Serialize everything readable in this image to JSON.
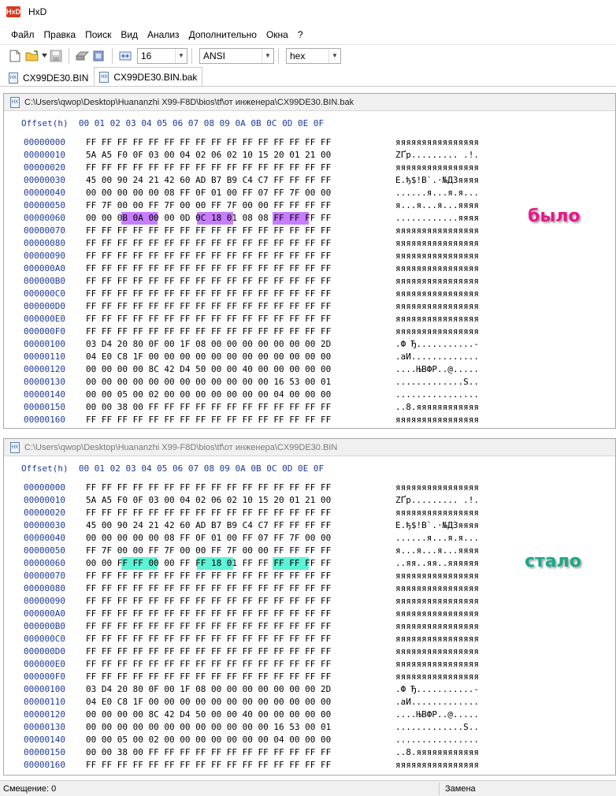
{
  "app": {
    "title": "HxD",
    "logo_text": "HxD"
  },
  "menu": [
    "Файл",
    "Правка",
    "Поиск",
    "Вид",
    "Анализ",
    "Дополнительно",
    "Окна",
    "?"
  ],
  "toolbar": {
    "icons": [
      "new-file-icon",
      "open-file-icon",
      "save-icon",
      "disk-icon",
      "ram-icon",
      "columns-icon"
    ],
    "bytes_per_row": "16",
    "charset": "ANSI",
    "display_mode": "hex"
  },
  "tabs": [
    {
      "label": "CX99DE30.BIN",
      "active": false
    },
    {
      "label": "CX99DE30.BIN.bak",
      "active": true
    }
  ],
  "header_row": "Offset(h)  00 01 02 03 04 05 06 07 08 09 0A 0B 0C 0D 0E 0F",
  "panels": [
    {
      "path": "C:\\Users\\qwop\\Desktop\\Huananzhi X99-F8D\\bios\\tf\\от инженера\\CX99DE30.BIN.bak",
      "label": "было",
      "label_color": "#e6198a",
      "highlight_color": "#c77dff",
      "highlights": [
        [
          6,
          2,
          3
        ],
        [
          6,
          6,
          7
        ],
        [
          6,
          10,
          11
        ]
      ],
      "rows": [
        {
          "offset": "00000000",
          "hex": "FF FF FF FF FF FF FF FF FF FF FF FF FF FF FF FF",
          "ascii": "яяяяяяяяяяяяяяяя"
        },
        {
          "offset": "00000010",
          "hex": "5A A5 F0 0F 03 00 04 02 06 02 10 15 20 01 21 00",
          "ascii": "ZҐр......... .!."
        },
        {
          "offset": "00000020",
          "hex": "FF FF FF FF FF FF FF FF FF FF FF FF FF FF FF FF",
          "ascii": "яяяяяяяяяяяяяяяя"
        },
        {
          "offset": "00000030",
          "hex": "45 00 90 24 21 42 60 AD B7 B9 C4 C7 FF FF FF FF",
          "ascii": "E.ђ$!B`.·№ДЗяяяя"
        },
        {
          "offset": "00000040",
          "hex": "00 00 00 00 00 08 FF 0F 01 00 FF 07 FF 7F 00 00",
          "ascii": "......я...я.я..."
        },
        {
          "offset": "00000050",
          "hex": "FF 7F 00 00 FF 7F 00 00 FF 7F 00 00 FF FF FF FF",
          "ascii": "я...я...я...яяяя"
        },
        {
          "offset": "00000060",
          "hex": "00 00 0B 0A 00 00 0D 0C 18 01 08 08 FF FF FF FF",
          "ascii": "............яяяя"
        },
        {
          "offset": "00000070",
          "hex": "FF FF FF FF FF FF FF FF FF FF FF FF FF FF FF FF",
          "ascii": "яяяяяяяяяяяяяяяя"
        },
        {
          "offset": "00000080",
          "hex": "FF FF FF FF FF FF FF FF FF FF FF FF FF FF FF FF",
          "ascii": "яяяяяяяяяяяяяяяя"
        },
        {
          "offset": "00000090",
          "hex": "FF FF FF FF FF FF FF FF FF FF FF FF FF FF FF FF",
          "ascii": "яяяяяяяяяяяяяяяя"
        },
        {
          "offset": "000000A0",
          "hex": "FF FF FF FF FF FF FF FF FF FF FF FF FF FF FF FF",
          "ascii": "яяяяяяяяяяяяяяяя"
        },
        {
          "offset": "000000B0",
          "hex": "FF FF FF FF FF FF FF FF FF FF FF FF FF FF FF FF",
          "ascii": "яяяяяяяяяяяяяяяя"
        },
        {
          "offset": "000000C0",
          "hex": "FF FF FF FF FF FF FF FF FF FF FF FF FF FF FF FF",
          "ascii": "яяяяяяяяяяяяяяяя"
        },
        {
          "offset": "000000D0",
          "hex": "FF FF FF FF FF FF FF FF FF FF FF FF FF FF FF FF",
          "ascii": "яяяяяяяяяяяяяяяя"
        },
        {
          "offset": "000000E0",
          "hex": "FF FF FF FF FF FF FF FF FF FF FF FF FF FF FF FF",
          "ascii": "яяяяяяяяяяяяяяяя"
        },
        {
          "offset": "000000F0",
          "hex": "FF FF FF FF FF FF FF FF FF FF FF FF FF FF FF FF",
          "ascii": "яяяяяяяяяяяяяяяя"
        },
        {
          "offset": "00000100",
          "hex": "03 D4 20 80 0F 00 1F 08 00 00 00 00 00 00 00 2D",
          "ascii": ".Ф Ђ...........-"
        },
        {
          "offset": "00000110",
          "hex": "04 E0 C8 1F 00 00 00 00 00 00 00 00 00 00 00 00",
          "ascii": ".аИ............."
        },
        {
          "offset": "00000120",
          "hex": "00 00 00 00 8C 42 D4 50 00 00 40 00 00 00 00 00",
          "ascii": "....ЊBФP..@....."
        },
        {
          "offset": "00000130",
          "hex": "00 00 00 00 00 00 00 00 00 00 00 00 16 53 00 01",
          "ascii": ".............S.."
        },
        {
          "offset": "00000140",
          "hex": "00 00 05 00 02 00 00 00 00 00 00 00 04 00 00 00",
          "ascii": "................"
        },
        {
          "offset": "00000150",
          "hex": "00 00 38 00 FF FF FF FF FF FF FF FF FF FF FF FF",
          "ascii": "..8.яяяяяяяяяяяя"
        },
        {
          "offset": "00000160",
          "hex": "FF FF FF FF FF FF FF FF FF FF FF FF FF FF FF FF",
          "ascii": "яяяяяяяяяяяяяяяя"
        }
      ]
    },
    {
      "path": "C:\\Users\\qwop\\Desktop\\Huananzhi X99-F8D\\bios\\tf\\от инженера\\CX99DE30.BIN",
      "label": "стало",
      "label_color": "#1aa88a",
      "highlight_color": "#5ef2d6",
      "highlights": [
        [
          6,
          2,
          3
        ],
        [
          6,
          6,
          7
        ],
        [
          6,
          10,
          11
        ]
      ],
      "rows": [
        {
          "offset": "00000000",
          "hex": "FF FF FF FF FF FF FF FF FF FF FF FF FF FF FF FF",
          "ascii": "яяяяяяяяяяяяяяяя"
        },
        {
          "offset": "00000010",
          "hex": "5A A5 F0 0F 03 00 04 02 06 02 10 15 20 01 21 00",
          "ascii": "ZҐр......... .!."
        },
        {
          "offset": "00000020",
          "hex": "FF FF FF FF FF FF FF FF FF FF FF FF FF FF FF FF",
          "ascii": "яяяяяяяяяяяяяяяя"
        },
        {
          "offset": "00000030",
          "hex": "45 00 90 24 21 42 60 AD B7 B9 C4 C7 FF FF FF FF",
          "ascii": "E.ђ$!B`.·№ДЗяяяя"
        },
        {
          "offset": "00000040",
          "hex": "00 00 00 00 00 08 FF 0F 01 00 FF 07 FF 7F 00 00",
          "ascii": "......я...я.я..."
        },
        {
          "offset": "00000050",
          "hex": "FF 7F 00 00 FF 7F 00 00 FF 7F 00 00 FF FF FF FF",
          "ascii": "я...я...я...яяяя"
        },
        {
          "offset": "00000060",
          "hex": "00 00 FF FF 00 00 FF FF 18 01 FF FF FF FF FF FF",
          "ascii": "..яя..яя..яяяяяя"
        },
        {
          "offset": "00000070",
          "hex": "FF FF FF FF FF FF FF FF FF FF FF FF FF FF FF FF",
          "ascii": "яяяяяяяяяяяяяяяя"
        },
        {
          "offset": "00000080",
          "hex": "FF FF FF FF FF FF FF FF FF FF FF FF FF FF FF FF",
          "ascii": "яяяяяяяяяяяяяяяя"
        },
        {
          "offset": "00000090",
          "hex": "FF FF FF FF FF FF FF FF FF FF FF FF FF FF FF FF",
          "ascii": "яяяяяяяяяяяяяяяя"
        },
        {
          "offset": "000000A0",
          "hex": "FF FF FF FF FF FF FF FF FF FF FF FF FF FF FF FF",
          "ascii": "яяяяяяяяяяяяяяяя"
        },
        {
          "offset": "000000B0",
          "hex": "FF FF FF FF FF FF FF FF FF FF FF FF FF FF FF FF",
          "ascii": "яяяяяяяяяяяяяяяя"
        },
        {
          "offset": "000000C0",
          "hex": "FF FF FF FF FF FF FF FF FF FF FF FF FF FF FF FF",
          "ascii": "яяяяяяяяяяяяяяяя"
        },
        {
          "offset": "000000D0",
          "hex": "FF FF FF FF FF FF FF FF FF FF FF FF FF FF FF FF",
          "ascii": "яяяяяяяяяяяяяяяя"
        },
        {
          "offset": "000000E0",
          "hex": "FF FF FF FF FF FF FF FF FF FF FF FF FF FF FF FF",
          "ascii": "яяяяяяяяяяяяяяяя"
        },
        {
          "offset": "000000F0",
          "hex": "FF FF FF FF FF FF FF FF FF FF FF FF FF FF FF FF",
          "ascii": "яяяяяяяяяяяяяяяя"
        },
        {
          "offset": "00000100",
          "hex": "03 D4 20 80 0F 00 1F 08 00 00 00 00 00 00 00 2D",
          "ascii": ".Ф Ђ...........-"
        },
        {
          "offset": "00000110",
          "hex": "04 E0 C8 1F 00 00 00 00 00 00 00 00 00 00 00 00",
          "ascii": ".аИ............."
        },
        {
          "offset": "00000120",
          "hex": "00 00 00 00 8C 42 D4 50 00 00 40 00 00 00 00 00",
          "ascii": "....ЊBФP..@....."
        },
        {
          "offset": "00000130",
          "hex": "00 00 00 00 00 00 00 00 00 00 00 00 16 53 00 01",
          "ascii": ".............S.."
        },
        {
          "offset": "00000140",
          "hex": "00 00 05 00 02 00 00 00 00 00 00 00 04 00 00 00",
          "ascii": "................"
        },
        {
          "offset": "00000150",
          "hex": "00 00 38 00 FF FF FF FF FF FF FF FF FF FF FF FF",
          "ascii": "..8.яяяяяяяяяяяя"
        },
        {
          "offset": "00000160",
          "hex": "FF FF FF FF FF FF FF FF FF FF FF FF FF FF FF FF",
          "ascii": "яяяяяяяяяяяяяяяя"
        }
      ]
    }
  ],
  "status": {
    "offset": "Смещение: 0",
    "mode": "Замена"
  }
}
